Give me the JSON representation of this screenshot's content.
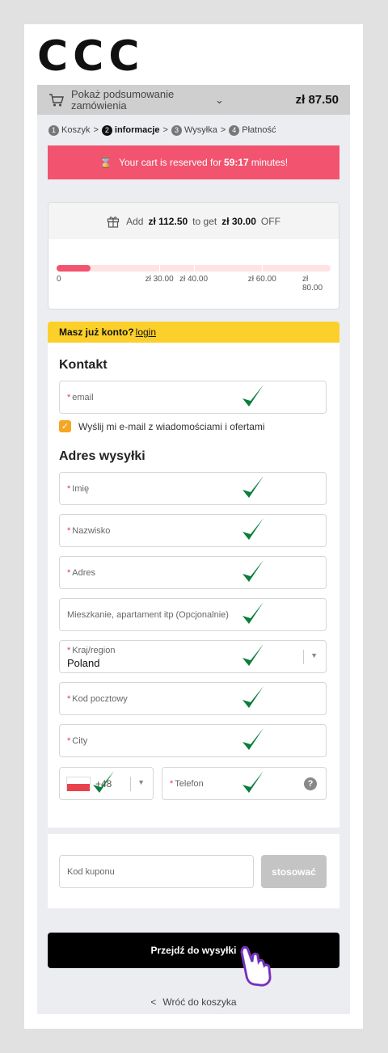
{
  "brand": {
    "logo_text": "CCC"
  },
  "summary": {
    "icon": "cart-icon",
    "label": "Pokaż podsumowanie zamówienia",
    "chevron": "⌄",
    "total": "zł 87.50"
  },
  "steps": [
    {
      "num": "1",
      "label": "Koszyk"
    },
    {
      "num": "2",
      "label": "informacje"
    },
    {
      "num": "3",
      "label": "Wysyłka"
    },
    {
      "num": "4",
      "label": "Płatność"
    }
  ],
  "steps_sep": ">",
  "timer": {
    "icon": "hourglass-icon",
    "prefix": "Your cart is reserved for",
    "time": "59:17",
    "suffix": "minutes!",
    "color": "#f2536e"
  },
  "promo": {
    "icon": "gift-icon",
    "add_label": "Add",
    "add_amount": "zł 112.50",
    "mid_label": "to get",
    "discount": "zł 30.00",
    "off_label": "OFF",
    "progress": {
      "current": 10,
      "max": 80
    },
    "ticks": [
      "0",
      "zł 30.00",
      "zł 40.00",
      "zł 60.00",
      "zł 80.00"
    ],
    "tick_values": [
      0,
      30,
      40,
      60,
      80
    ]
  },
  "account": {
    "question": "Masz już konto?",
    "login": "login",
    "color": "#fcd02a"
  },
  "contact": {
    "heading": "Kontakt",
    "email_label": "email",
    "newsletter_label": "Wyślij mi e-mail z wiadomościami i ofertami",
    "newsletter_checked": true
  },
  "shipping": {
    "heading": "Adres wysyłki",
    "first_name": "Imię",
    "last_name": "Nazwisko",
    "address": "Adres",
    "apartment": "Mieszkanie, apartament itp (Opcjonalnie)",
    "country_label": "Kraj/region",
    "country_value": "Poland",
    "postal": "Kod pocztowy",
    "city": "City",
    "phone_code": "+48",
    "phone_label": "Telefon",
    "required_mark": "*",
    "help_icon": "?"
  },
  "coupon": {
    "placeholder": "Kod kuponu",
    "apply": "stosować"
  },
  "cta": {
    "label": "Przejdź do wysyłki"
  },
  "back": {
    "label": "Wróć do koszyka",
    "chevron": "<"
  },
  "colors": {
    "accent": "#f2536e",
    "check": "#0b7d3b",
    "checkbox": "#f5a623"
  }
}
